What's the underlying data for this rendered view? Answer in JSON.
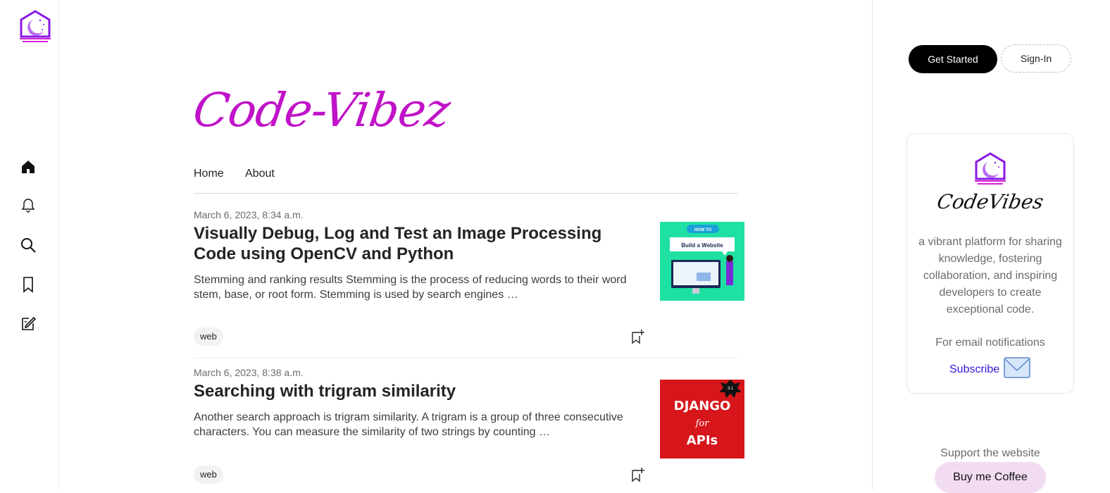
{
  "app": {
    "brand_title": "Code-Vibez"
  },
  "rail": {
    "icons": [
      "home-icon",
      "bell-icon",
      "search-icon",
      "bookmark-icon",
      "write-icon"
    ]
  },
  "nav": {
    "items": [
      "Home",
      "About"
    ]
  },
  "posts": [
    {
      "date": "March 6, 2023, 8:34 a.m.",
      "title": "Visually Debug, Log and Test an Image Processing Code using OpenCV and Python",
      "excerpt": "Stemming and ranking results Stemming is the process of reducing words to their word stem, base, or root form. Stemming is used by search engines …",
      "tag": "web",
      "thumb": {
        "badge": "HOW TO",
        "caption": "Build a Website",
        "bg": "#1ee0a3"
      }
    },
    {
      "date": "March 6, 2023, 8:38 a.m.",
      "title": "Searching with trigram similarity",
      "excerpt": "Another search approach is trigram similarity. A trigram is a group of three consecutive characters. You can measure the similarity of two strings by counting …",
      "tag": "web",
      "thumb": {
        "line1": "DJANGO",
        "line2": "for",
        "line3": "APIs",
        "star": "3.1",
        "bg": "#d7161b"
      }
    }
  ],
  "right": {
    "get_started": "Get Started",
    "sign_in": "Sign-In",
    "card": {
      "logo_text": "CodeVibes",
      "description": "a vibrant platform for sharing knowledge, fostering collaboration, and inspiring developers to create exceptional code.",
      "notify": "For email notifications",
      "subscribe": "Subscribe"
    },
    "support": "Support the website",
    "coffee": "Buy me Coffee"
  },
  "colors": {
    "brand": "#c012c8",
    "link": "#3218d8",
    "accent_purple": "#7a2bd8"
  }
}
